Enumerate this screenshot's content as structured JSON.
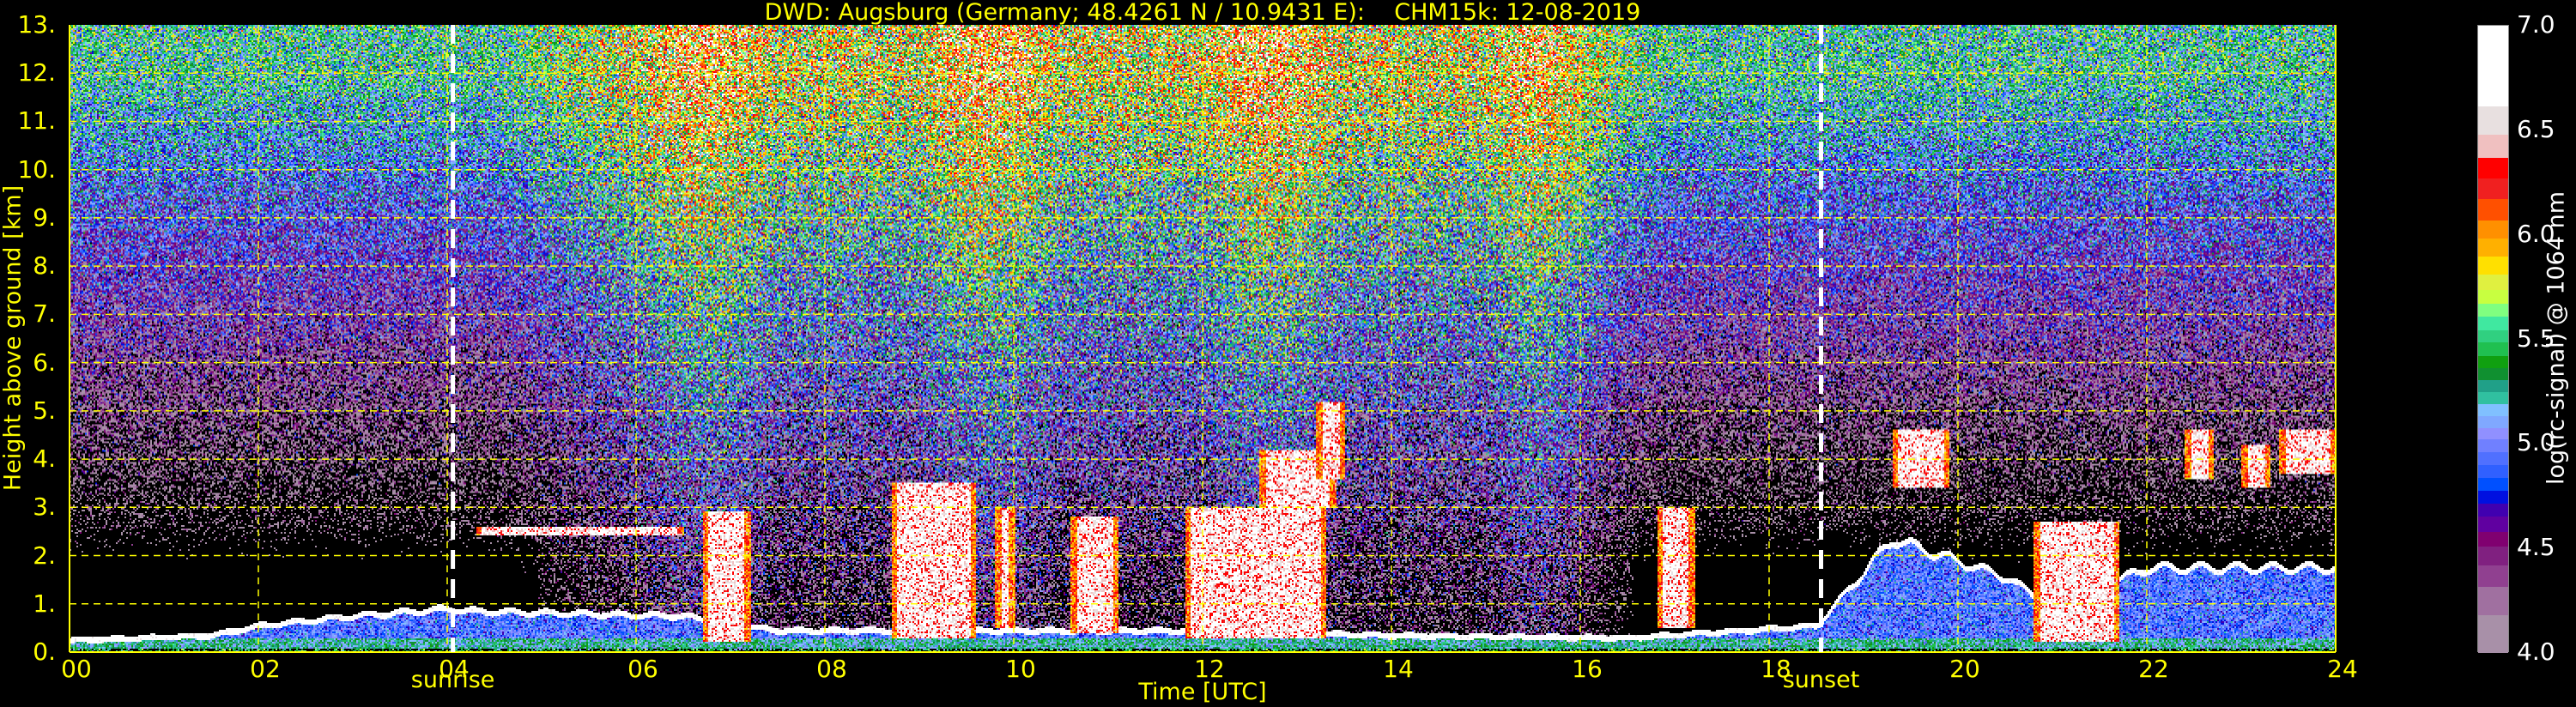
{
  "chart_data": {
    "type": "heatmap",
    "title": "DWD: Augsburg (Germany; 48.4261 N / 10.9431 E):    CHM15k: 12-08-2019",
    "xlabel": "Time [UTC]",
    "ylabel": "Height above ground [km]",
    "xlim": [
      0,
      24
    ],
    "ylim": [
      0,
      13
    ],
    "xticks": [
      0,
      2,
      4,
      6,
      8,
      10,
      12,
      14,
      16,
      18,
      20,
      22,
      24
    ],
    "xtick_labels": [
      "00",
      "02",
      "04",
      "06",
      "08",
      "10",
      "12",
      "14",
      "16",
      "18",
      "20",
      "22",
      "24"
    ],
    "yticks": [
      0,
      1,
      2,
      3,
      4,
      5,
      6,
      7,
      8,
      9,
      10,
      11,
      12,
      13
    ],
    "ytick_labels": [
      "0.",
      "1.",
      "2.",
      "3.",
      "4.",
      "5.",
      "6.",
      "7.",
      "8.",
      "9.",
      "10.",
      "11.",
      "12.",
      "13."
    ],
    "grid": true,
    "annotations": [
      {
        "label": "sunrise",
        "time": 4.06
      },
      {
        "label": "sunset",
        "time": 18.55
      }
    ],
    "colorbar": {
      "label": "log(rc-signal) @ 1064 nm",
      "range": [
        4.0,
        7.0
      ],
      "ticks": [
        4.0,
        4.5,
        5.0,
        5.5,
        6.0,
        6.5,
        7.0
      ],
      "tick_labels": [
        "4.0",
        "4.5",
        "5.0",
        "5.5",
        "6.0",
        "6.5",
        "7.0"
      ],
      "levels": [
        4.0,
        4.184,
        4.318,
        4.422,
        4.512,
        4.582,
        4.653,
        4.718,
        4.778,
        4.841,
        4.901,
        4.962,
        5.022,
        5.079,
        5.135,
        5.191,
        5.249,
        5.308,
        5.364,
        5.42,
        5.487,
        5.545,
        5.61,
        5.673,
        5.738,
        5.813,
        5.898,
        5.984,
        6.071,
        6.172,
        6.272,
        6.369,
        6.481,
        6.617,
        7.0
      ],
      "colors": [
        "#a890a8",
        "#a070a0",
        "#904090",
        "#802080",
        "#800070",
        "#6000a0",
        "#4000b0",
        "#0010e0",
        "#0050ff",
        "#3060ff",
        "#5070ff",
        "#7080ff",
        "#9090ff",
        "#80a8ff",
        "#80c0ff",
        "#30c0a0",
        "#20a088",
        "#109030",
        "#10a010",
        "#20c050",
        "#30d080",
        "#40e8a0",
        "#80ff80",
        "#c8ff40",
        "#e0f040",
        "#ffe000",
        "#ffb000",
        "#ff9000",
        "#ff5000",
        "#f02020",
        "#ff0000",
        "#f0c0c0",
        "#e8e0e0",
        "#ffffff"
      ]
    },
    "features": {
      "boundary_layer_km": [
        [
          0,
          0.3
        ],
        [
          1.5,
          0.4
        ],
        [
          2,
          0.6
        ],
        [
          3,
          0.8
        ],
        [
          4,
          0.95
        ],
        [
          4.3,
          0.9
        ],
        [
          6.5,
          0.8
        ],
        [
          7.5,
          0.5
        ],
        [
          12,
          0.5
        ],
        [
          14,
          0.4
        ],
        [
          16.5,
          0.35
        ],
        [
          18.5,
          0.6
        ],
        [
          19.3,
          2.4
        ],
        [
          20.5,
          1.6
        ],
        [
          21,
          1.0
        ],
        [
          22,
          1.8
        ],
        [
          24,
          1.8
        ]
      ],
      "clouds": [
        [
          4.3,
          6.5,
          2.4,
          2.6
        ],
        [
          6.7,
          7.2,
          0.2,
          2.9
        ],
        [
          8.7,
          9.6,
          0.3,
          3.5
        ],
        [
          9.8,
          10.0,
          0.5,
          3.0
        ],
        [
          10.6,
          11.1,
          0.4,
          2.8
        ],
        [
          11.8,
          13.3,
          0.3,
          3.0
        ],
        [
          12.6,
          13.4,
          3.0,
          4.2
        ],
        [
          13.2,
          13.5,
          3.6,
          5.2
        ],
        [
          16.8,
          17.2,
          0.5,
          3.0
        ],
        [
          19.3,
          19.9,
          3.4,
          4.6
        ],
        [
          20.8,
          21.7,
          0.2,
          2.7
        ],
        [
          22.4,
          22.7,
          3.6,
          4.6
        ],
        [
          23.0,
          23.3,
          3.4,
          4.3
        ],
        [
          23.4,
          24,
          3.7,
          4.6
        ]
      ]
    },
    "colors": {
      "text": "#ffff00",
      "grid": "#ffff00",
      "daymarker": "#ffffff"
    }
  }
}
